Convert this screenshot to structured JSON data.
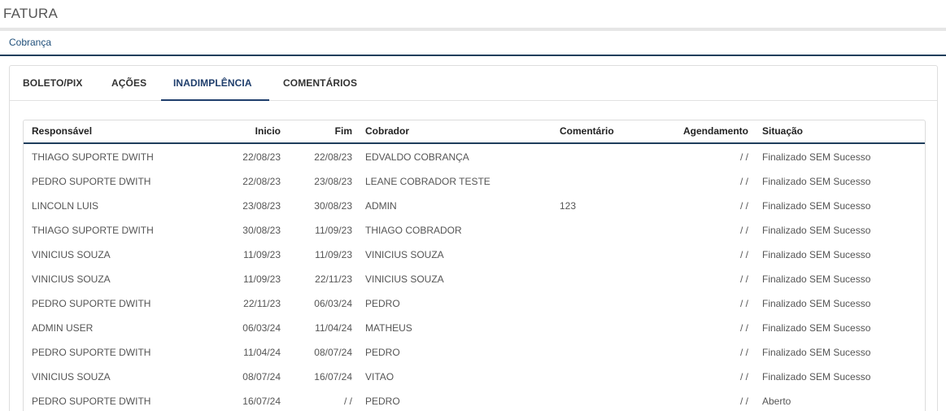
{
  "page": {
    "title": "FATURA"
  },
  "breadcrumb": {
    "label": "Cobrança"
  },
  "tabs": [
    {
      "label": "BOLETO/PIX",
      "active": false
    },
    {
      "label": "AÇÕES",
      "active": false
    },
    {
      "label": "INADIMPLÊNCIA",
      "active": true
    },
    {
      "label": "COMENTÁRIOS",
      "active": false
    }
  ],
  "table": {
    "headers": {
      "responsavel": "Responsável",
      "inicio": "Inicio",
      "fim": "Fim",
      "cobrador": "Cobrador",
      "comentario": "Comentário",
      "agendamento": "Agendamento",
      "situacao": "Situação"
    },
    "rows": [
      {
        "responsavel": "THIAGO SUPORTE DWITH",
        "inicio": "22/08/23",
        "fim": "22/08/23",
        "cobrador": "EDVALDO COBRANÇA",
        "comentario": "",
        "agendamento": "/ /",
        "situacao": "Finalizado SEM Sucesso"
      },
      {
        "responsavel": "PEDRO SUPORTE DWITH",
        "inicio": "22/08/23",
        "fim": "23/08/23",
        "cobrador": "LEANE COBRADOR TESTE",
        "comentario": "",
        "agendamento": "/ /",
        "situacao": "Finalizado SEM Sucesso"
      },
      {
        "responsavel": "LINCOLN LUIS",
        "inicio": "23/08/23",
        "fim": "30/08/23",
        "cobrador": "ADMIN",
        "comentario": "123",
        "agendamento": "/ /",
        "situacao": "Finalizado SEM Sucesso"
      },
      {
        "responsavel": "THIAGO SUPORTE DWITH",
        "inicio": "30/08/23",
        "fim": "11/09/23",
        "cobrador": "THIAGO COBRADOR",
        "comentario": "",
        "agendamento": "/ /",
        "situacao": "Finalizado SEM Sucesso"
      },
      {
        "responsavel": "VINICIUS SOUZA",
        "inicio": "11/09/23",
        "fim": "11/09/23",
        "cobrador": "VINICIUS SOUZA",
        "comentario": "",
        "agendamento": "/ /",
        "situacao": "Finalizado SEM Sucesso"
      },
      {
        "responsavel": "VINICIUS SOUZA",
        "inicio": "11/09/23",
        "fim": "22/11/23",
        "cobrador": "VINICIUS SOUZA",
        "comentario": "",
        "agendamento": "/ /",
        "situacao": "Finalizado SEM Sucesso"
      },
      {
        "responsavel": "PEDRO SUPORTE DWITH",
        "inicio": "22/11/23",
        "fim": "06/03/24",
        "cobrador": "PEDRO",
        "comentario": "",
        "agendamento": "/ /",
        "situacao": "Finalizado SEM Sucesso"
      },
      {
        "responsavel": "ADMIN USER",
        "inicio": "06/03/24",
        "fim": "11/04/24",
        "cobrador": "MATHEUS",
        "comentario": "",
        "agendamento": "/ /",
        "situacao": "Finalizado SEM Sucesso"
      },
      {
        "responsavel": "PEDRO SUPORTE DWITH",
        "inicio": "11/04/24",
        "fim": "08/07/24",
        "cobrador": "PEDRO",
        "comentario": "",
        "agendamento": "/ /",
        "situacao": "Finalizado SEM Sucesso"
      },
      {
        "responsavel": "VINICIUS SOUZA",
        "inicio": "08/07/24",
        "fim": "16/07/24",
        "cobrador": "VITAO",
        "comentario": "",
        "agendamento": "/ /",
        "situacao": "Finalizado SEM Sucesso"
      },
      {
        "responsavel": "PEDRO SUPORTE DWITH",
        "inicio": "16/07/24",
        "fim": "/ /",
        "cobrador": "PEDRO",
        "comentario": "",
        "agendamento": "/ /",
        "situacao": "Aberto"
      }
    ]
  }
}
